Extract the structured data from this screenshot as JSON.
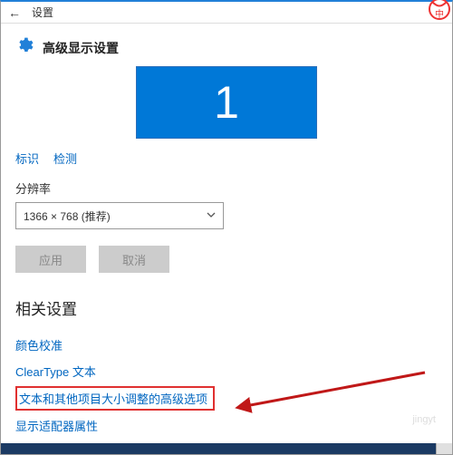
{
  "titlebar": {
    "title": "设置"
  },
  "header": {
    "title": "高级显示设置"
  },
  "monitor": {
    "number": "1"
  },
  "links": {
    "identify": "标识",
    "detect": "检测"
  },
  "resolution": {
    "label": "分辨率",
    "value": "1366 × 768 (推荐)"
  },
  "buttons": {
    "apply": "应用",
    "cancel": "取消"
  },
  "related": {
    "title": "相关设置",
    "color": "颜色校准",
    "cleartype": "ClearType 文本",
    "advanced_sizing": "文本和其他项目大小调整的高级选项",
    "adapter": "显示适配器属性"
  },
  "watermark": "jingyt",
  "external_icon_char": "中"
}
